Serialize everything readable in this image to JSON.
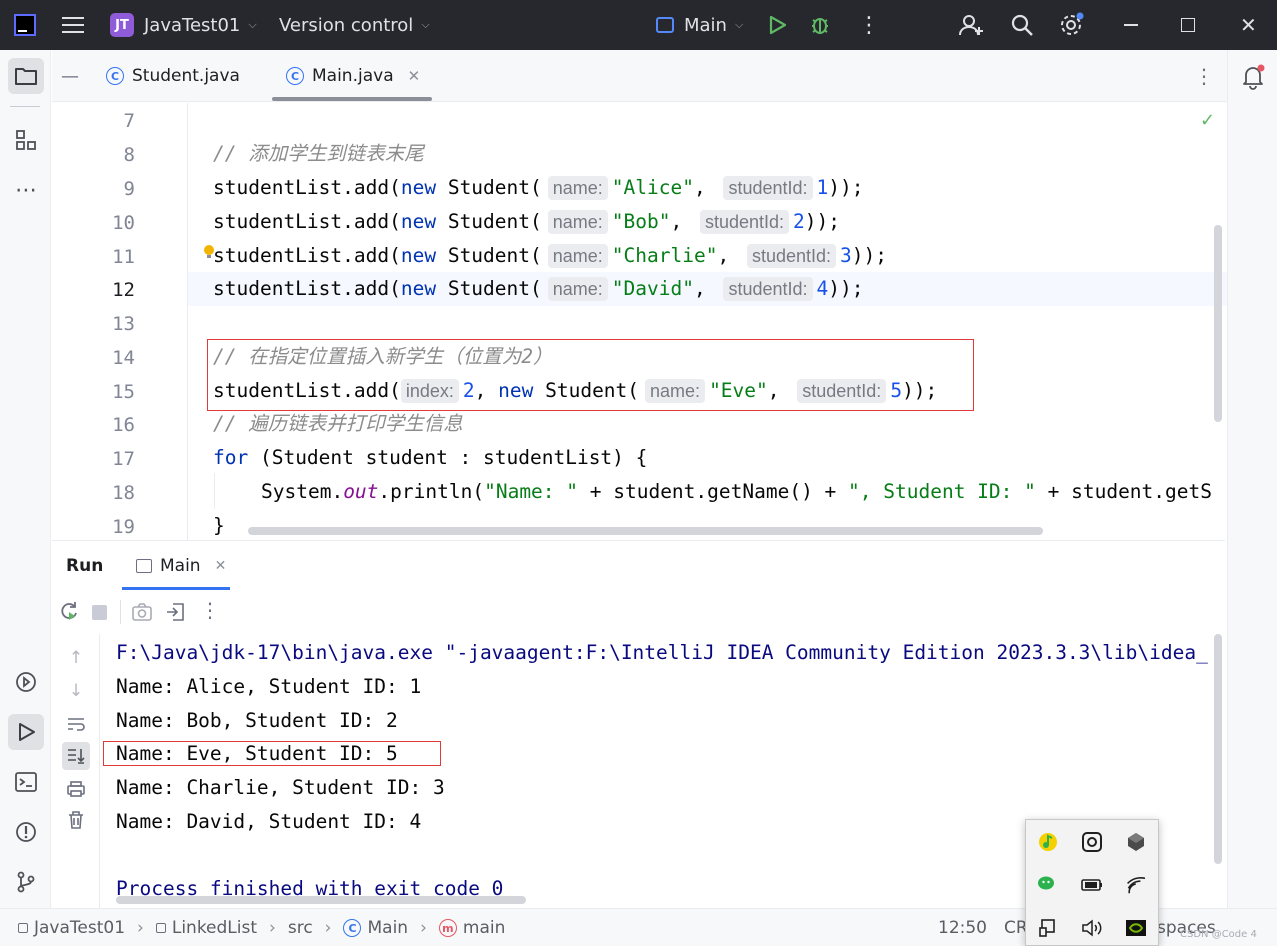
{
  "titlebar": {
    "project_badge": "JT",
    "project_name": "JavaTest01",
    "vcs_label": "Version control",
    "run_config": "Main"
  },
  "tabs": [
    {
      "label": "Student.java",
      "icon": "class-icon"
    },
    {
      "label": "Main.java",
      "icon": "class-icon",
      "active": true
    }
  ],
  "editor": {
    "line_numbers": [
      "7",
      "8",
      "9",
      "10",
      "11",
      "12",
      "13",
      "14",
      "15",
      "16",
      "17",
      "18",
      "19"
    ],
    "comment_add_tail": "// 添加学生到链表末尾",
    "comment_insert": "// 在指定位置插入新学生（位置为2）",
    "comment_iterate": "// 遍历链表并打印学生信息",
    "hint_name": "name:",
    "hint_studentId": "studentId:",
    "hint_index": "index:",
    "student_list": "studentList",
    "add_call": ".add(",
    "kw_new": "new",
    "kw_for": "for",
    "class_student": "Student(",
    "students": [
      {
        "name": "\"Alice\"",
        "id": "1"
      },
      {
        "name": "\"Bob\"",
        "id": "2"
      },
      {
        "name": "\"Charlie\"",
        "id": "3"
      },
      {
        "name": "\"David\"",
        "id": "4"
      }
    ],
    "insert_index": "2",
    "insert_name": "\"Eve\"",
    "insert_id": "5",
    "for_rest": " (Student student : studentList) {",
    "print_system": "System.",
    "print_out": "out",
    "print_call": ".println(",
    "print_str1": "\"Name: \"",
    "print_mid1": " + student.getName() + ",
    "print_str2": "\", Student ID: \"",
    "print_mid2": " + student.getS",
    "close_brace": "}"
  },
  "run": {
    "title": "Run",
    "tab_label": "Main",
    "console_lines": [
      "F:\\Java\\jdk-17\\bin\\java.exe \"-javaagent:F:\\IntelliJ IDEA Community Edition 2023.3.3\\lib\\idea_",
      "Name: Alice, Student ID: 1",
      "Name: Bob, Student ID: 2",
      "Name: Eve, Student ID: 5",
      "Name: Charlie, Student ID: 3",
      "Name: David, Student ID: 4",
      "",
      "Process finished with exit code 0"
    ]
  },
  "statusbar": {
    "crumbs": [
      "JavaTest01",
      "LinkedList",
      "src",
      "Main",
      "main"
    ],
    "position": "12:50",
    "line_sep": "CR",
    "indent": "spaces",
    "watermark": "CSDN @Code 4"
  },
  "colors": {
    "accent": "#3574f0",
    "highlight_box": "#e03a3a",
    "titlebar_bg": "#27282e"
  }
}
